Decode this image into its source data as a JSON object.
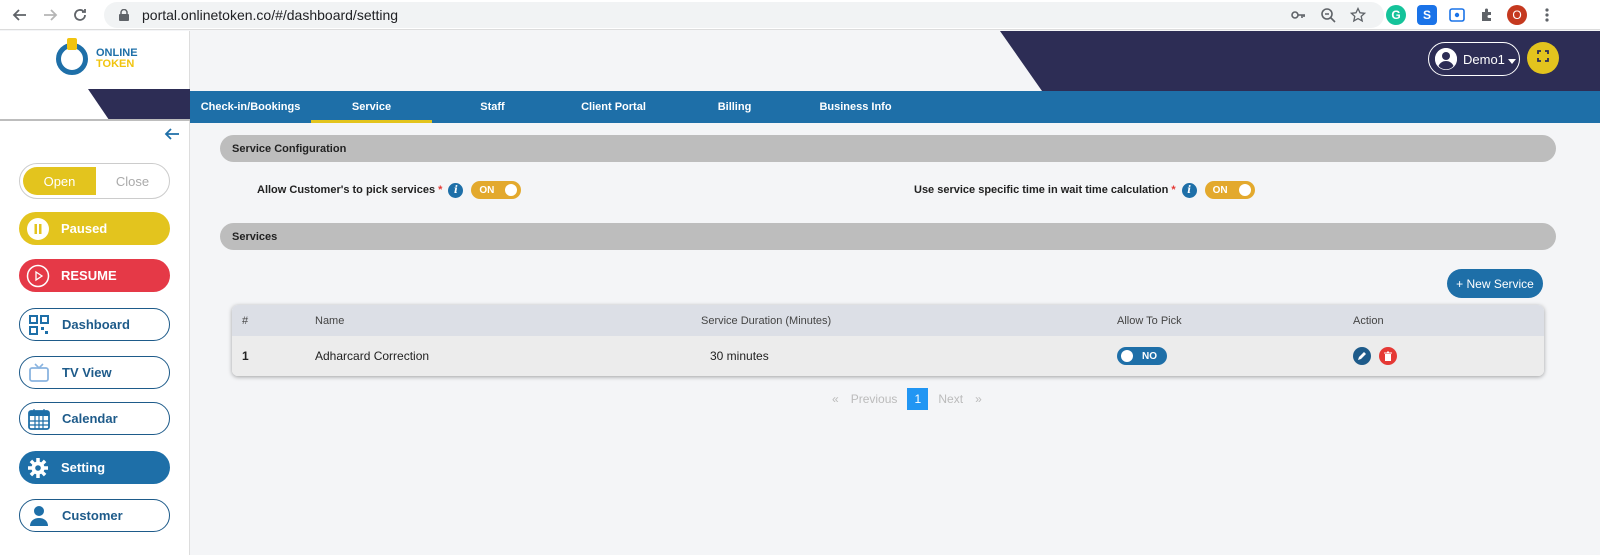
{
  "browser": {
    "url": "portal.onlinetoken.co/#/dashboard/setting",
    "profile_initial": "O"
  },
  "brand": {
    "line1": "ONLINE",
    "line2": "TOKEN"
  },
  "sidebar": {
    "open_label": "Open",
    "close_label": "Close",
    "paused_label": "Paused",
    "resume_label": "RESUME",
    "items": [
      {
        "label": "Dashboard"
      },
      {
        "label": "TV View"
      },
      {
        "label": "Calendar"
      },
      {
        "label": "Setting"
      },
      {
        "label": "Customer"
      }
    ]
  },
  "header": {
    "user_label": "Demo1"
  },
  "tabs": [
    {
      "label": "Check-in/Bookings"
    },
    {
      "label": "Service"
    },
    {
      "label": "Staff"
    },
    {
      "label": "Client Portal"
    },
    {
      "label": "Billing"
    },
    {
      "label": "Business Info"
    }
  ],
  "service_configuration": {
    "title": "Service Configuration",
    "allow_pick_label": "Allow Customer's to pick services",
    "allow_pick_value": "ON",
    "service_time_label": "Use service specific time in wait time calculation",
    "service_time_value": "ON",
    "required_mark": "*"
  },
  "services": {
    "title": "Services",
    "new_button": "+ New Service",
    "columns": [
      "#",
      "Name",
      "Service Duration (Minutes)",
      "Allow To Pick",
      "Action"
    ],
    "rows": [
      {
        "num": "1",
        "name": "Adharcard Correction",
        "duration": "30 minutes",
        "allow": "NO"
      }
    ]
  },
  "pagination": {
    "prev_arrow": "«",
    "previous": "Previous",
    "current": "1",
    "next": "Next",
    "next_arrow": "»"
  },
  "colors": {
    "primary": "#1e6fa8",
    "accent": "#e3c41e",
    "dark": "#2d2d55",
    "danger": "#e53947"
  }
}
